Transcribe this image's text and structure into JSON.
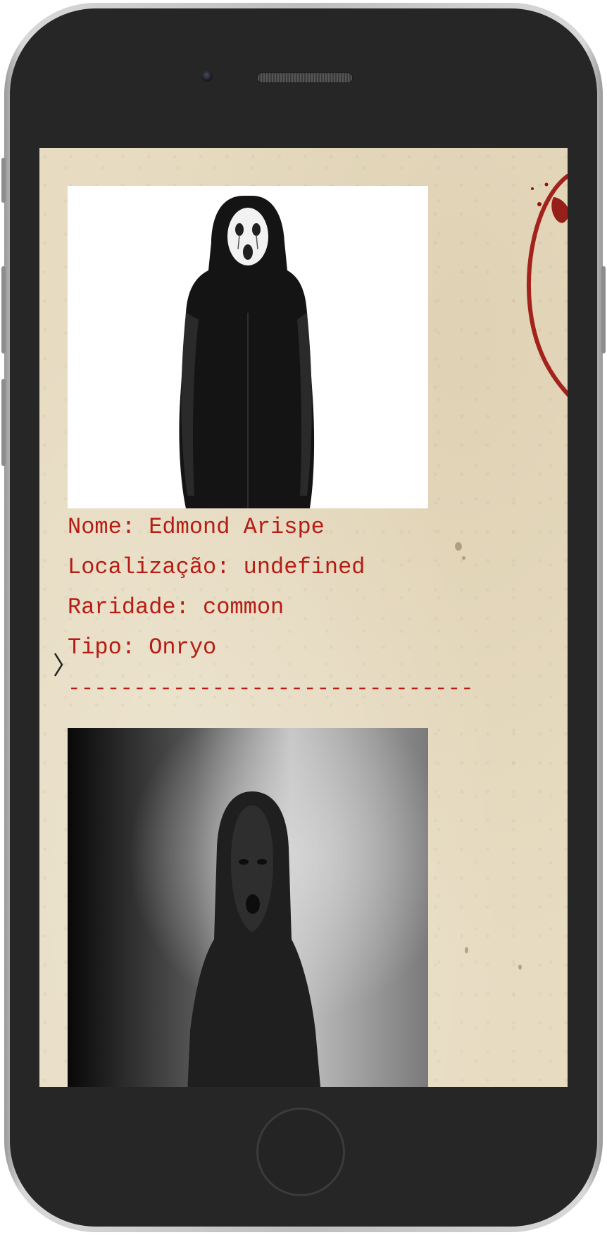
{
  "feed": {
    "divider_text": "-------------------------------",
    "cards": [
      {
        "image_icon": "white-masked-ghost-figure-image",
        "name_line": "Nome: Edmond Arispe",
        "location_line": "Localização: undefined",
        "rarity_line": "Raridade: common",
        "type_line": "Tipo: Onryo"
      },
      {
        "image_icon": "dark-hooded-ghost-image"
      }
    ]
  },
  "colors": {
    "text": "#b51d14",
    "paper": "#e7dcc2",
    "phone_body": "#262626",
    "blood": "#9b0f0a"
  }
}
